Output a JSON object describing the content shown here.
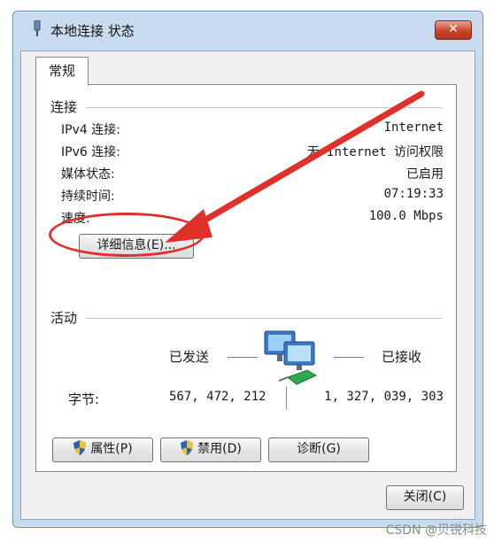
{
  "window": {
    "title": "本地连接 状态",
    "close_glyph": "✕"
  },
  "tabs": [
    {
      "label": "常规",
      "selected": true
    }
  ],
  "connection": {
    "heading": "连接",
    "rows": [
      {
        "label": "IPv4 连接:",
        "value": "Internet"
      },
      {
        "label": "IPv6 连接:",
        "value": "无 Internet 访问权限"
      },
      {
        "label": "媒体状态:",
        "value": "已启用"
      },
      {
        "label": "持续时间:",
        "value": "07:19:33"
      },
      {
        "label": "速度:",
        "value": "100.0 Mbps"
      }
    ],
    "details_button": "详细信息(E)..."
  },
  "activity": {
    "heading": "活动",
    "sent_label": "已发送",
    "received_label": "已接收",
    "bytes_label": "字节:",
    "bytes_sent": "567, 472, 212",
    "bytes_received": "1, 327, 039, 303",
    "icon": "network-computers-icon"
  },
  "actions": {
    "properties": "属性(P)",
    "disable": "禁用(D)",
    "diagnose": "诊断(G)"
  },
  "footer": {
    "close": "关闭(C)"
  },
  "watermark": "CSDN @贝锐科技",
  "colors": {
    "annotation": "#e0302a",
    "shield_blue": "#2a62b8",
    "shield_yellow": "#f2c12e"
  }
}
